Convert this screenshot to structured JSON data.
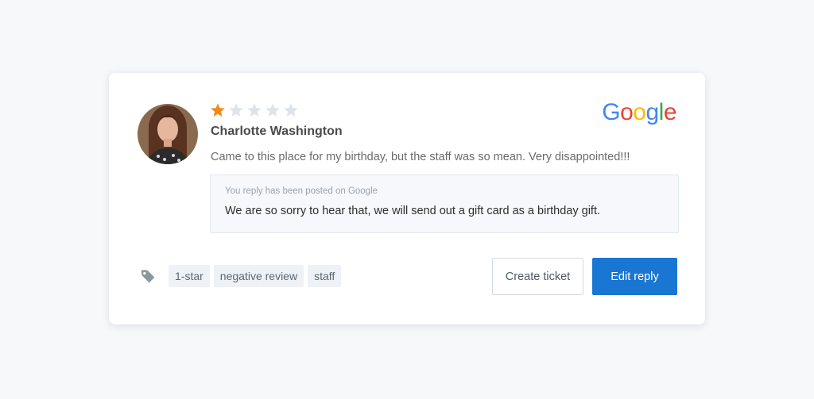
{
  "review": {
    "rating": 1,
    "max_rating": 5,
    "reviewer_name": "Charlotte Washington",
    "text": "Came to this place for my birthday, but the staff was so mean. Very disappointed!!!",
    "source_logo": "Google"
  },
  "reply": {
    "status": "You reply has been posted on Google",
    "text": "We are so sorry to hear that, we will send out a gift card as a birthday gift."
  },
  "tags": [
    "1-star",
    "negative review",
    "staff"
  ],
  "actions": {
    "create_ticket_label": "Create ticket",
    "edit_reply_label": "Edit reply"
  },
  "colors": {
    "star_filled": "#f28a1b",
    "star_empty": "#dfe4ea",
    "primary_button": "#1976d2",
    "background": "#f6f8fa",
    "google_blue": "#4285f4",
    "google_red": "#ea4335",
    "google_yellow": "#fbbc05",
    "google_green": "#34a853"
  },
  "icons": {
    "tag": "tag-icon",
    "star": "star-icon",
    "avatar": "avatar"
  }
}
